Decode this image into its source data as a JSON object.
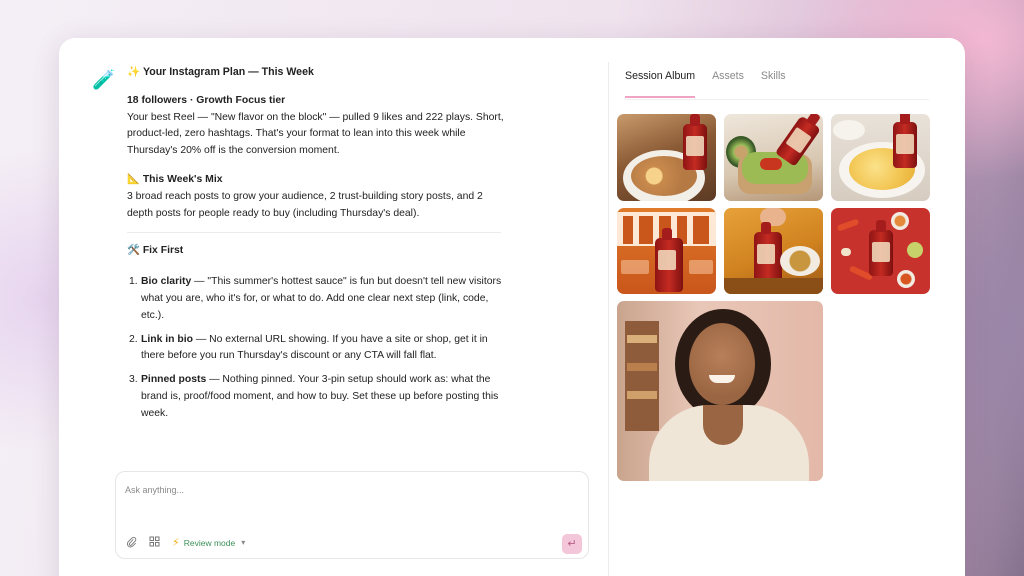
{
  "chat": {
    "title": "✨ Your Instagram Plan — This Week",
    "avatar_icon": "🧪",
    "tier_heading": "18 followers · Growth Focus tier",
    "tier_body": "Your best Reel — \"New flavor on the block\" — pulled 9 likes and 222 plays. Short, product-led, zero hashtags. That's your format to lean into this week while Thursday's 20% off is the conversion moment.",
    "mix_heading": "📐 This Week's Mix",
    "mix_body": "3 broad reach posts to grow your audience, 2 trust-building story posts, and 2 depth posts for people ready to buy (including Thursday's deal).",
    "fix_heading": "🛠️ Fix First",
    "fixes": [
      {
        "num": "1.",
        "label": "Bio clarity",
        "text": " — \"This summer's hottest sauce\" is fun but doesn't tell new visitors what you are, who it's for, or what to do. Add one clear next step (link, code, etc.)."
      },
      {
        "num": "2.",
        "label": "Link in bio",
        "text": " — No external URL showing. If you have a site or shop, get it in there before you run Thursday's discount or any CTA will fall flat."
      },
      {
        "num": "3.",
        "label": "Pinned posts",
        "text": " — Nothing pinned. Your 3-pin setup should work as: what the brand is, proof/food moment, and how to buy. Set these up before posting this week."
      }
    ]
  },
  "composer": {
    "placeholder": "Ask anything...",
    "mode_label": "Review mode",
    "attach_icon": "paperclip-icon",
    "grid_icon": "grid-icon",
    "send_icon": "enter-icon"
  },
  "album": {
    "tabs": [
      {
        "label": "Session Album",
        "active": true
      },
      {
        "label": "Assets",
        "active": false
      },
      {
        "label": "Skills",
        "active": false
      }
    ],
    "images": [
      {
        "name": "ramen-with-sauce-photo"
      },
      {
        "name": "avocado-toast-sauce-photo"
      },
      {
        "name": "scrambled-eggs-sauce-photo"
      },
      {
        "name": "taste-poster-sauce-photo"
      },
      {
        "name": "hand-holding-sauce-photo"
      },
      {
        "name": "sauce-chili-flatlay-photo"
      },
      {
        "name": "smiling-woman-portrait-photo"
      }
    ]
  },
  "colors": {
    "accent_pink": "#f0a3c3",
    "sauce_red": "#c42b22",
    "review_green": "#3d8f5a"
  }
}
